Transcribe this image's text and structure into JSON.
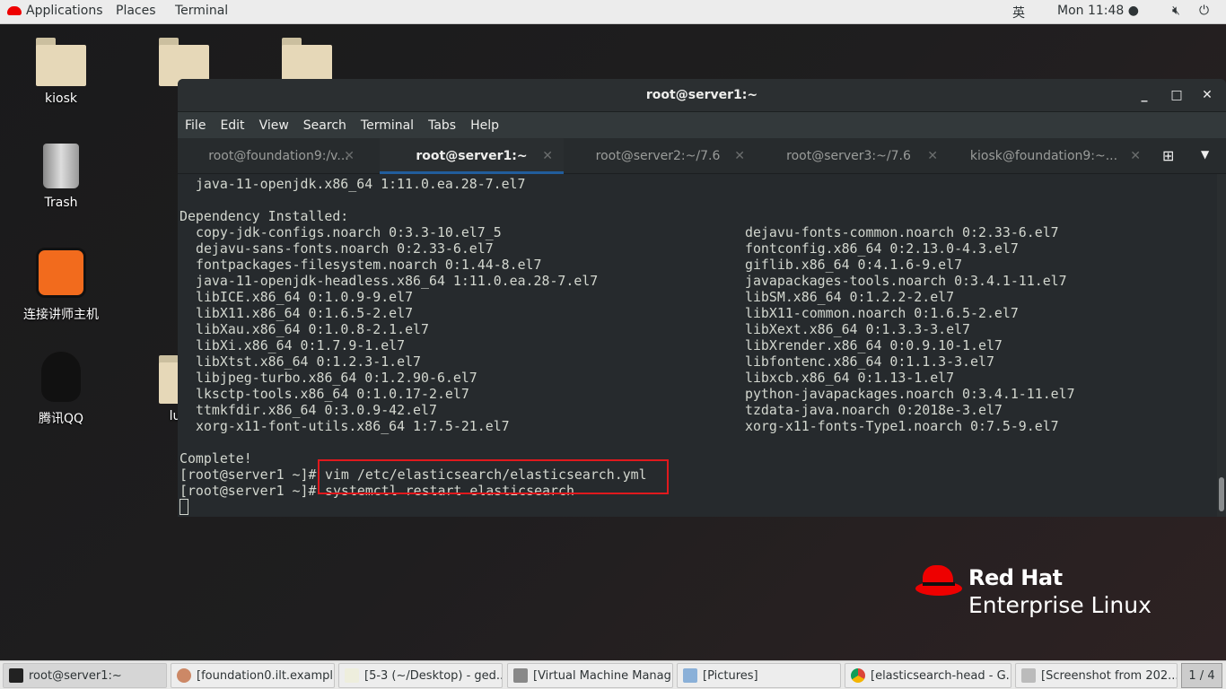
{
  "topbar": {
    "applications": "Applications",
    "places": "Places",
    "terminal": "Terminal",
    "input_method": "英",
    "clock": "Mon 11:48 ●"
  },
  "desktop": [
    {
      "label": "kiosk"
    },
    {
      "label": "Trash"
    },
    {
      "label": "连接讲师主机"
    },
    {
      "label": "腾讯QQ"
    },
    {
      "label": "luxic"
    }
  ],
  "window": {
    "title": "root@server1:~",
    "menu": [
      "File",
      "Edit",
      "View",
      "Search",
      "Terminal",
      "Tabs",
      "Help"
    ],
    "tabs": [
      {
        "label": "root@foundation9:/v..."
      },
      {
        "label": "root@server1:~"
      },
      {
        "label": "root@server2:~/7.6"
      },
      {
        "label": "root@server3:~/7.6"
      },
      {
        "label": "kiosk@foundation9:~..."
      }
    ]
  },
  "terminal": {
    "first_line": "  java-11-openjdk.x86_64 1:11.0.ea.28-7.el7",
    "dep_header": "Dependency Installed:",
    "left": [
      "copy-jdk-configs.noarch 0:3.3-10.el7_5",
      "dejavu-sans-fonts.noarch 0:2.33-6.el7",
      "fontpackages-filesystem.noarch 0:1.44-8.el7",
      "java-11-openjdk-headless.x86_64 1:11.0.ea.28-7.el7",
      "libICE.x86_64 0:1.0.9-9.el7",
      "libX11.x86_64 0:1.6.5-2.el7",
      "libXau.x86_64 0:1.0.8-2.1.el7",
      "libXi.x86_64 0:1.7.9-1.el7",
      "libXtst.x86_64 0:1.2.3-1.el7",
      "libjpeg-turbo.x86_64 0:1.2.90-6.el7",
      "lksctp-tools.x86_64 0:1.0.17-2.el7",
      "ttmkfdir.x86_64 0:3.0.9-42.el7",
      "xorg-x11-font-utils.x86_64 1:7.5-21.el7"
    ],
    "right": [
      "dejavu-fonts-common.noarch 0:2.33-6.el7",
      "fontconfig.x86_64 0:2.13.0-4.3.el7",
      "giflib.x86_64 0:4.1.6-9.el7",
      "javapackages-tools.noarch 0:3.4.1-11.el7",
      "libSM.x86_64 0:1.2.2-2.el7",
      "libX11-common.noarch 0:1.6.5-2.el7",
      "libXext.x86_64 0:1.3.3-3.el7",
      "libXrender.x86_64 0:0.9.10-1.el7",
      "libfontenc.x86_64 0:1.1.3-3.el7",
      "libxcb.x86_64 0:1.13-1.el7",
      "python-javapackages.noarch 0:3.4.1-11.el7",
      "tzdata-java.noarch 0:2018e-3.el7",
      "xorg-x11-fonts-Type1.noarch 0:7.5-9.el7"
    ],
    "complete": "Complete!",
    "prompt": "[root@server1 ~]# ",
    "cmd1": "vim /etc/elasticsearch/elasticsearch.yml",
    "cmd2": "systemctl restart elasticsearch"
  },
  "logo": {
    "line1": "Red Hat",
    "line2": "Enterprise Linux"
  },
  "taskbar": [
    {
      "label": "root@server1:~",
      "icon": "terminal-icon"
    },
    {
      "label": "[foundation0.ilt.exampl...",
      "icon": "remote-viewer-icon"
    },
    {
      "label": "[5-3 (~/Desktop) - ged...",
      "icon": "gedit-icon"
    },
    {
      "label": "[Virtual Machine Manag...",
      "icon": "virt-manager-icon"
    },
    {
      "label": "[Pictures]",
      "icon": "file-manager-icon"
    },
    {
      "label": "[elasticsearch-head - G...",
      "icon": "chrome-icon"
    },
    {
      "label": "[Screenshot from 202...",
      "icon": "screenshot-icon"
    }
  ],
  "workspace": "1 / 4",
  "colors": {
    "highlight_box": "#e0191d",
    "active_tab_underline": "#215d9c",
    "redhat": "#ee0000"
  }
}
